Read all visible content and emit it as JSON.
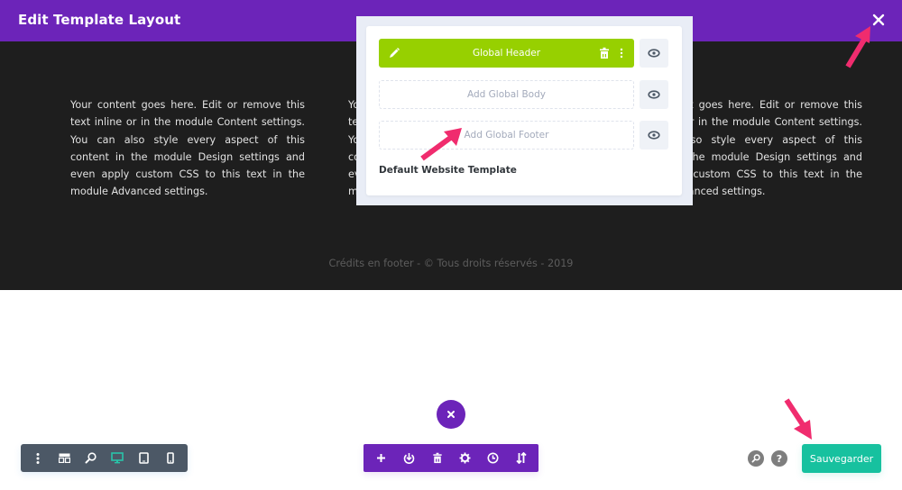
{
  "window": {
    "title": "Edit Template Layout"
  },
  "content": {
    "column_text": "Your content goes here. Edit or remove this text inline or in the module Content settings. You can also style every aspect of this content in the module Design settings and even apply custom CSS to this text in the module Advanced settings.",
    "footer_credit": "Crédits en footer - © Tous droits réservés - 2019"
  },
  "template": {
    "areas": [
      {
        "label": "Global Header",
        "state": "assigned"
      },
      {
        "label": "Add Global Body",
        "state": "empty"
      },
      {
        "label": "Add Global Footer",
        "state": "empty"
      }
    ],
    "name": "Default Website Template"
  },
  "toolbars": {
    "left": [
      "menu-icon",
      "wireframe-icon",
      "zoom-icon",
      "desktop-icon",
      "tablet-icon",
      "phone-icon"
    ],
    "left_active": "desktop-icon",
    "center": [
      "add-icon",
      "portability-icon",
      "trash-icon",
      "settings-icon",
      "history-icon",
      "sort-icon"
    ]
  },
  "actions": {
    "save_label": "Sauvegarder",
    "help_label": "?"
  },
  "colors": {
    "brand_purple": "#6c24b9",
    "header_green": "#97d000",
    "save_teal": "#17c19f",
    "annotation_pink": "#f02c6e",
    "active_icon": "#29c4a9"
  }
}
